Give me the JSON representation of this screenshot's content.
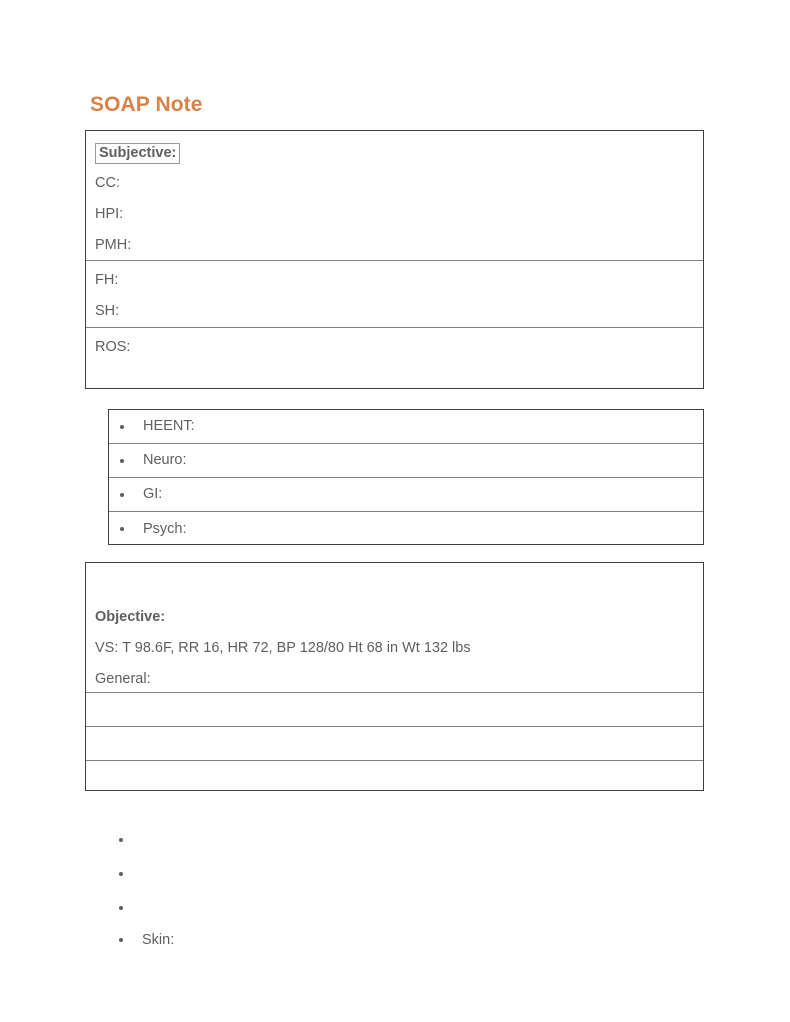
{
  "document": {
    "title": "SOAP Note",
    "title_color": "#d98247",
    "text_color": "#5f5f5f",
    "border_color": "#3f3f3f",
    "rule_color": "#808080"
  },
  "subjective_table": {
    "rows": [
      {
        "boxed_label": "Subjective:",
        "lines": [
          "CC:",
          "HPI:",
          "PMH:"
        ]
      },
      {
        "lines": [
          "FH:",
          "SH:"
        ]
      },
      {
        "lines": [
          "ROS:"
        ]
      }
    ]
  },
  "systems_table": {
    "rows": [
      {
        "bullet": "•",
        "label": "HEENT:"
      },
      {
        "bullet": "•",
        "label": "Neuro:"
      },
      {
        "bullet": "•",
        "label": "GI:"
      },
      {
        "bullet": "•",
        "label": "Psych:"
      }
    ]
  },
  "objective_table": {
    "heading": "Objective:",
    "vitals": "VS: T 98.6F, RR 16, HR 72, BP 128/80 Ht 68 in Wt 132 lbs",
    "general": "General:",
    "empty_rows": [
      "",
      "",
      ""
    ]
  },
  "trailing_bullets": {
    "items": [
      {
        "bullet": "•",
        "label": ""
      },
      {
        "bullet": "•",
        "label": ""
      },
      {
        "bullet": "•",
        "label": ""
      },
      {
        "bullet": "•",
        "label": "Skin:"
      }
    ]
  }
}
